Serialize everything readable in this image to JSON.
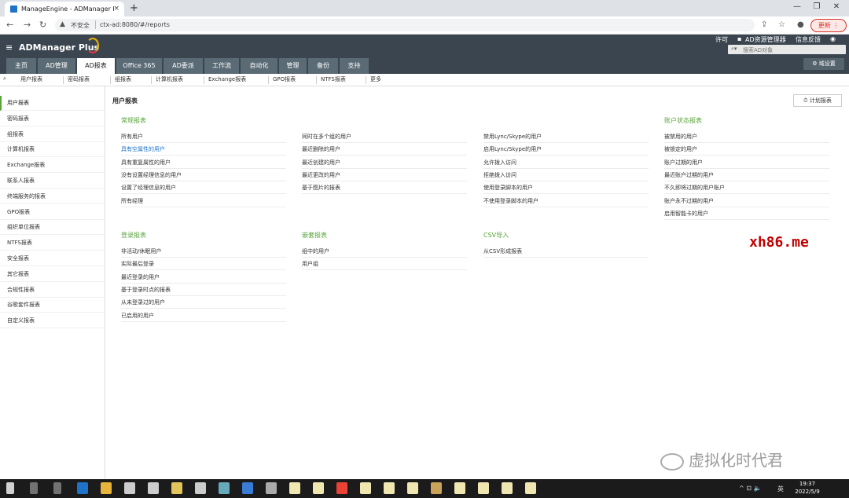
{
  "browser": {
    "tab_title": "ManageEngine - ADManager P",
    "tab_close": "×",
    "new_tab": "+",
    "window_controls": [
      "—",
      "❐",
      "✕"
    ],
    "nav": {
      "back": "←",
      "forward": "→",
      "reload": "↻"
    },
    "insecure_label": "不安全",
    "url": "ctx-ad:8080/#/reports",
    "update_label": "更新 ⋮"
  },
  "app": {
    "logo": "ADManager Plus",
    "menu_icon": "≡",
    "top_links": [
      "许可",
      "AD资源管理器",
      "信息反馈"
    ],
    "user_icon": "◉",
    "search_placeholder": "搜索AD对象",
    "domain_settings": "⚙ 域设置",
    "nav_tabs": [
      "主页",
      "AD管理",
      "AD报表",
      "Office 365",
      "AD委派",
      "工作流",
      "自动化",
      "管理",
      "备份",
      "支持"
    ],
    "active_tab": "AD报表",
    "sub_nav": [
      "用户报表",
      "密码报表",
      "组报表",
      "计算机报表",
      "Exchange报表",
      "GPO报表",
      "NTFS报表",
      "更多"
    ]
  },
  "sidebar": {
    "items": [
      "用户报表",
      "密码报表",
      "组报表",
      "计算机报表",
      "Exchange报表",
      "联系人报表",
      "终端服务的报表",
      "GPO报表",
      "组织单位报表",
      "NTFS报表",
      "安全报表",
      "其它报表",
      "合规性报表",
      "谷歌套件报表",
      "自定义报表"
    ],
    "active": "用户报表"
  },
  "main": {
    "title": "用户报表",
    "schedule_button": "计划报表",
    "sections": [
      {
        "title": "常规报表",
        "items": [
          "所有用户",
          "具有空属性的用户",
          "具有重复属性的用户",
          "没有设置经理信息的用户",
          "设置了经理信息的用户",
          "所有经理"
        ]
      },
      {
        "title": "",
        "items": [
          "同时在多个组的用户",
          "最近删除的用户",
          "最近创建的用户",
          "最近更改的用户",
          "基于图片的报表"
        ]
      },
      {
        "title": "",
        "items": [
          "禁用Lync/Skype的用户",
          "启用Lync/Skype的用户",
          "允许拨入访问",
          "拒绝拨入访问",
          "使用登录脚本的用户",
          "不使用登录脚本的用户"
        ]
      },
      {
        "title": "账户状态报表",
        "items": [
          "被禁用的用户",
          "被锁定的用户",
          "账户过期的用户",
          "最近账户过期的用户",
          "不久即将过期的用户账户",
          "账户永不过期的用户",
          "启用智能卡的用户"
        ]
      },
      {
        "title": "登录报表",
        "items": [
          "非活动/休眠用户",
          "实际最后登录",
          "最近登录的用户",
          "基于登录时点的报表",
          "从未登录过的用户",
          "已启用的用户"
        ]
      },
      {
        "title": "嵌套报表",
        "items": [
          "组中的用户",
          "用户组"
        ]
      },
      {
        "title": "CSV导入",
        "items": [
          "从CSV形成报表"
        ]
      }
    ],
    "highlighted_item": "具有空属性的用户"
  },
  "overlays": {
    "watermark": "xh86.me",
    "wechat_text": "虚拟化时代君"
  },
  "taskbar": {
    "time": "19:37",
    "date": "2022/5/9",
    "lang": "英",
    "tray_icons": "^ ⊡ 🔈"
  },
  "colors": {
    "header_bg": "#3a4550",
    "tab_bg": "#5a6b75",
    "accent_green": "#5aa33b",
    "link_blue": "#1e73c8",
    "watermark_red": "#c00000"
  }
}
